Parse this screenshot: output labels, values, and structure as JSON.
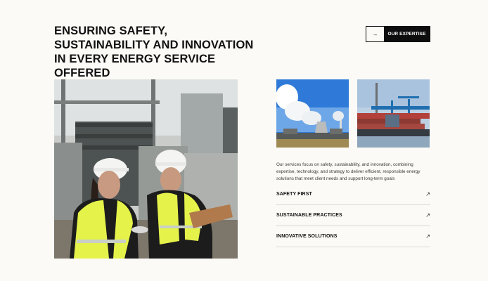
{
  "header": {
    "title": "ENSURING SAFETY, SUSTAINABILITY AND INNOVATION IN EVERY ENERGY SERVICE OFFERED",
    "cta": {
      "arrow": "→",
      "label": "OUR EXPERTISE"
    }
  },
  "content": {
    "description": "Our services focus on safety, sustainability, and innovation, combining expertise, technology, and strategy to deliver efficient, responsible energy solutions that meet client needs and support long-term goals",
    "services": [
      {
        "label": "SAFETY FIRST",
        "icon": "arrow-up-right-icon",
        "glyph": "↗"
      },
      {
        "label": "SUSTAINABLE PRACTICES",
        "icon": "arrow-up-right-icon",
        "glyph": "↗"
      },
      {
        "label": "INNOVATIVE SOLUTIONS",
        "icon": "arrow-up-right-icon",
        "glyph": "↗"
      }
    ]
  },
  "colors": {
    "background": "#fbfaf6",
    "text": "#111111",
    "cta_background": "#0d0d0d",
    "safety_vest": "#e4f24a"
  }
}
